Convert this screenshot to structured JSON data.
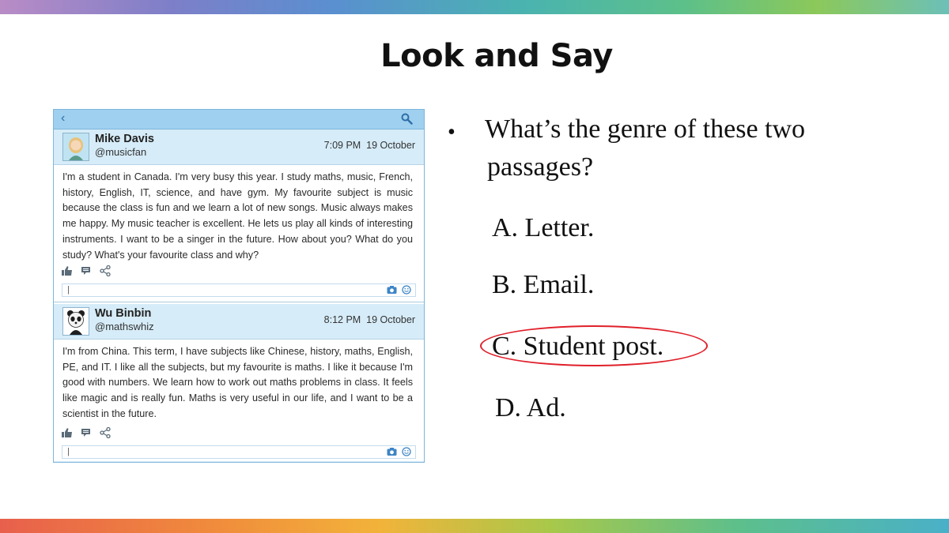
{
  "slide": {
    "title": "Look and Say"
  },
  "feed": {
    "posts": [
      {
        "name": "Mike Davis",
        "handle": "@musicfan",
        "time": "7:09 PM",
        "date": "19 October",
        "text": "I'm a student in Canada. I'm very busy this year. I study maths, music, French, history, English, IT, science, and have gym. My favourite subject is music because the class is fun and we learn a lot of new songs. Music always makes me happy. My music teacher is excellent. He lets us play all kinds of interesting instruments. I want to be a singer in the future. How about you? What do you study? What's your favourite class and why?",
        "avatar_icon": "girl-avatar-icon"
      },
      {
        "name": "Wu Binbin",
        "handle": "@mathswhiz",
        "time": "8:12 PM",
        "date": "19 October",
        "text": "I'm from China. This term, I have subjects like Chinese, history, maths, English, PE, and IT. I like all the subjects, but my favourite is maths. I like it because I'm good with numbers. We learn how to work out maths problems in class. It feels like magic and is really fun. Maths is very useful in our life, and I want to be a scientist in the future.",
        "avatar_icon": "panda-avatar-icon"
      }
    ],
    "comment_cursor": "|"
  },
  "question": {
    "bullet": "•",
    "line1": "What’s the genre of these two",
    "line2": "passages?",
    "options": [
      "A. Letter.",
      "B. Email.",
      "C. Student post.",
      "D. Ad."
    ],
    "correct_answer": "C. Student post."
  },
  "colors": {
    "answer_ring": "#e0202a",
    "feed_background": "#d6ecf8",
    "feed_bar": "#9fd0ef"
  }
}
